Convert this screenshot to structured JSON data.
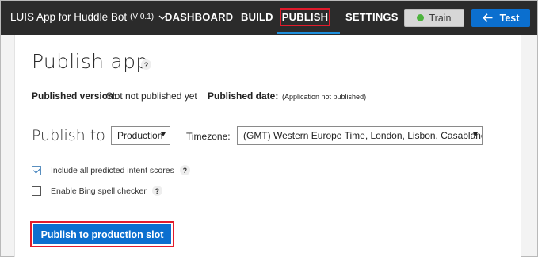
{
  "nav": {
    "app_name": "LUIS App for Huddle Bot",
    "version": "(V 0.1)",
    "items": [
      {
        "label": "DASHBOARD"
      },
      {
        "label": "BUILD"
      },
      {
        "label": "PUBLISH"
      },
      {
        "label": "SETTINGS"
      }
    ],
    "active": "PUBLISH",
    "train_label": "Train",
    "test_label": "Test"
  },
  "page": {
    "title": "Publish app",
    "help_glyph": "?",
    "published_version_label": "Published version:",
    "published_version_value": "Slot not published yet",
    "published_date_label": "Published date:",
    "published_date_value": "(Application not published)",
    "publish_to_label": "Publish to",
    "slot_selected": "Production",
    "timezone_label": "Timezone:",
    "timezone_selected": "(GMT) Western Europe Time, London, Lisbon, Casablanca",
    "checkboxes": [
      {
        "label": "Include all predicted intent scores",
        "checked": true
      },
      {
        "label": "Enable Bing spell checker",
        "checked": false
      }
    ],
    "publish_button_label": "Publish to production slot"
  },
  "colors": {
    "nav_bg": "#2b2b2b",
    "accent_blue": "#0b6fcf",
    "active_underline": "#1e8fdc",
    "highlight_red": "#e21b2b",
    "train_dot": "#4db33d"
  }
}
